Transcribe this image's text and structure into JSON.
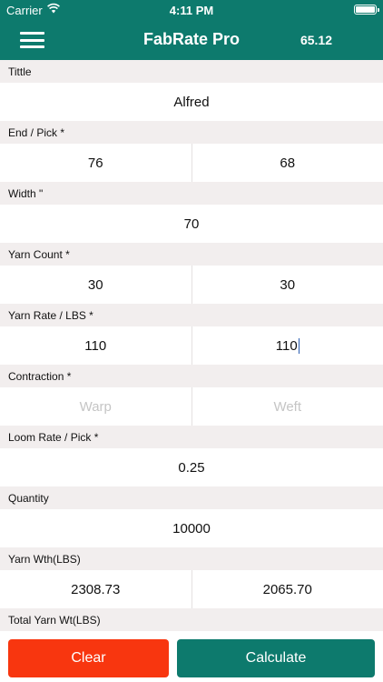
{
  "status_bar": {
    "carrier": "Carrier",
    "time": "4:11 PM"
  },
  "nav_bar": {
    "title": "FabRate Pro",
    "value": "65.12",
    "menu_icon": "hamburger-menu-icon",
    "color": "#0d7a6d"
  },
  "fields": {
    "title": {
      "label": "Tittle",
      "value": "Alfred"
    },
    "end_pick": {
      "label": "End / Pick *",
      "left": "76",
      "right": "68"
    },
    "width": {
      "label": "Width \"",
      "value": "70"
    },
    "yarn_count": {
      "label": "Yarn Count *",
      "left": "30",
      "right": "30"
    },
    "yarn_rate": {
      "label": "Yarn Rate / LBS *",
      "left": "110",
      "right": "110"
    },
    "contraction": {
      "label": "Contraction *",
      "left_placeholder": "Warp",
      "right_placeholder": "Weft"
    },
    "loom_rate": {
      "label": "Loom Rate / Pick *",
      "value": "0.25"
    },
    "quantity": {
      "label": "Quantity",
      "value": "10000"
    },
    "yarn_wth": {
      "label": "Yarn Wth(LBS)",
      "left": "2308.73",
      "right": "2065.70"
    },
    "total_yarn_wt": {
      "label": "Total Yarn Wt(LBS)"
    }
  },
  "buttons": {
    "clear": "Clear",
    "calculate": "Calculate",
    "clear_color": "#f8360f",
    "calculate_color": "#0d7a6d"
  }
}
